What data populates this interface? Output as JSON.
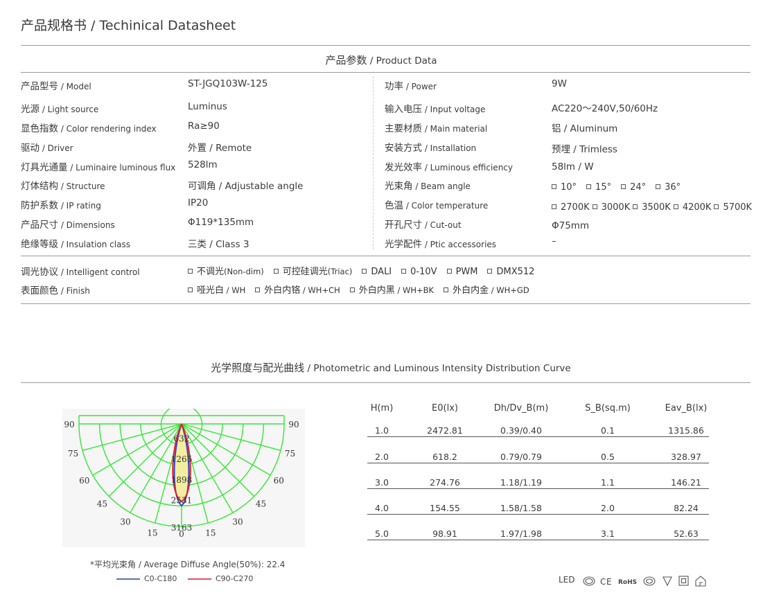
{
  "header": {
    "title": "产品规格书 / Techinical Datasheet"
  },
  "product_data": {
    "title_cn": "产品参数",
    "title_en": " / Product Data",
    "left_rows": [
      {
        "label_cn": "产品型号",
        "label_en": " / Model",
        "value": "ST-JGQ103W-125"
      },
      {
        "label_cn": "光源",
        "label_en": " / Light source",
        "value": "Luminus"
      },
      {
        "label_cn": "显色指数",
        "label_en": " / Color rendering index",
        "value": "Ra≥90"
      },
      {
        "label_cn": "驱动",
        "label_en": " / Driver",
        "value": "外置 / Remote"
      },
      {
        "label_cn": "灯具光通量",
        "label_en": " / Luminaire luminous flux",
        "value": "528lm"
      },
      {
        "label_cn": "灯体结构",
        "label_en": " / Structure",
        "value": "可调角 / Adjustable angle"
      },
      {
        "label_cn": "防护系数",
        "label_en": " / IP  rating",
        "value": "IP20"
      },
      {
        "label_cn": "产品尺寸",
        "label_en": " / Dimensions",
        "value": "Φ119*135mm"
      },
      {
        "label_cn": "绝缘等级",
        "label_en": " / Insulation class",
        "value": "三类 / Class 3"
      }
    ],
    "right_rows": [
      {
        "label_cn": "功率",
        "label_en": " / Power",
        "value": "9W"
      },
      {
        "label_cn": "输入电压",
        "label_en": " / Input voltage",
        "value": "AC220～240V,50/60Hz"
      },
      {
        "label_cn": "主要材质",
        "label_en": " / Main material",
        "value": "铝 / Aluminum"
      },
      {
        "label_cn": "安装方式",
        "label_en": " / Installation",
        "value": "预埋 / Trimless"
      },
      {
        "label_cn": "发光效率",
        "label_en": " / Luminous efficiency",
        "value": "58lm / W"
      },
      {
        "label_cn": "光束角",
        "label_en": " / Beam angle",
        "options": [
          "10°",
          "15°",
          "24°",
          "36°"
        ]
      },
      {
        "label_cn": "色温",
        "label_en": " / Color temperature",
        "options": [
          "2700K",
          "3000K",
          "3500K",
          "4200K",
          "5700K"
        ]
      },
      {
        "label_cn": "开孔尺寸",
        "label_en": " / Cut-out",
        "value": "Φ75mm"
      },
      {
        "label_cn": "光学配件",
        "label_en": " / Ptic accessories",
        "value": "–"
      }
    ],
    "control": {
      "label_cn": "调光协议",
      "label_en": " / Intelligent control",
      "options": [
        {
          "cn": "不调光",
          "en": "(Non-dim)"
        },
        {
          "cn": "可控硅调光",
          "en": "(Triac)"
        },
        {
          "cn": "DALI",
          "en": ""
        },
        {
          "cn": "0-10V",
          "en": ""
        },
        {
          "cn": "PWM",
          "en": ""
        },
        {
          "cn": "DMX512",
          "en": ""
        }
      ]
    },
    "finish": {
      "label_cn": "表面颜色",
      "label_en": " / Finish",
      "options": [
        {
          "cn": "哑光白",
          "en": " / WH"
        },
        {
          "cn": "外白内铬",
          "en": " / WH+CH"
        },
        {
          "cn": "外白内黑",
          "en": " / WH+BK"
        },
        {
          "cn": "外白内金",
          "en": " / WH+GD"
        }
      ]
    }
  },
  "photometric": {
    "title_cn": "光学照度与配光曲线",
    "title_en": " / Photometric and Luminous Intensity Distribution Curve",
    "polar": {
      "angle_labels_left": [
        "90",
        "75",
        "60",
        "45",
        "30",
        "15"
      ],
      "angle_labels_right": [
        "90",
        "75",
        "60",
        "45",
        "30",
        "15"
      ],
      "zero_label": "0",
      "intensity_labels": [
        "632",
        "1265",
        "1898",
        "2531",
        "3163"
      ],
      "colors": {
        "grid": "#33e833",
        "background": "#f6f6f6",
        "c0": "#3344cc",
        "c90": "#e8202a",
        "fill": "#f2ee9e"
      }
    },
    "note": "*平均光束角 / Average Diffuse Angle(50%): 22.4",
    "legend": [
      {
        "label": "C0-C180",
        "color": "#5470b8"
      },
      {
        "label": "C90-C270",
        "color": "#e05260"
      }
    ],
    "table": {
      "headers": [
        "H(m)",
        "E0(lx)",
        "Dh/Dv_B(m)",
        "S_B(sq.m)",
        "Eav_B(lx)"
      ],
      "rows": [
        [
          "1.0",
          "2472.81",
          "0.39/0.40",
          "0.1",
          "1315.86"
        ],
        [
          "2.0",
          "618.2",
          "0.79/0.79",
          "0.5",
          "328.97"
        ],
        [
          "3.0",
          "274.76",
          "1.18/1.19",
          "1.1",
          "146.21"
        ],
        [
          "4.0",
          "154.55",
          "1.58/1.58",
          "2.0",
          "82.24"
        ],
        [
          "5.0",
          "98.91",
          "1.97/1.98",
          "3.1",
          "52.63"
        ]
      ]
    }
  },
  "certifications": [
    "LED",
    "CCC",
    "CE",
    "RoHS",
    "CQC",
    "F",
    "class-II",
    "home"
  ]
}
